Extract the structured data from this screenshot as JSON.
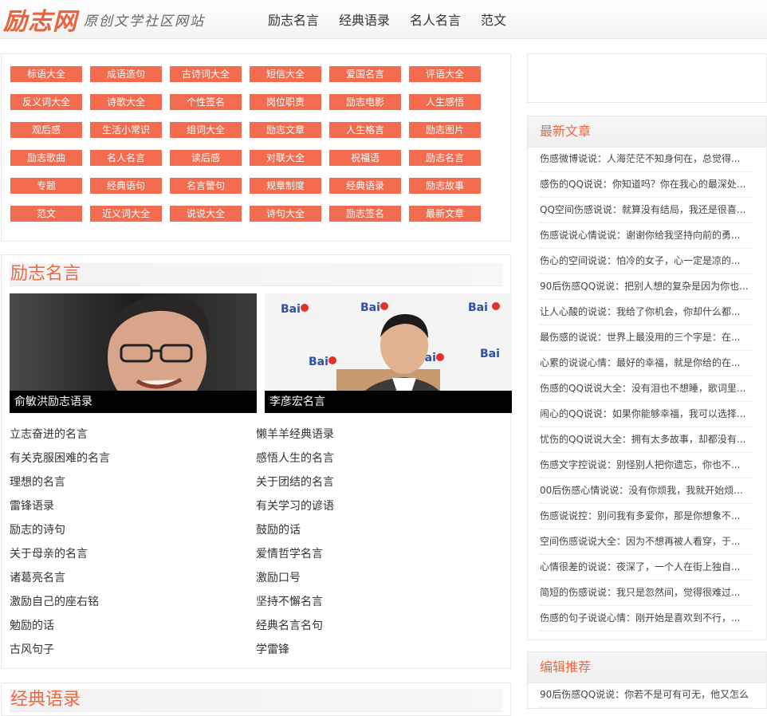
{
  "header": {
    "logo_main": "励志网",
    "logo_sub": "原创文学社区网站",
    "nav": [
      "励志名言",
      "经典语录",
      "名人名言",
      "范文"
    ]
  },
  "tags": [
    "标语大全",
    "成语造句",
    "古诗词大全",
    "短信大全",
    "爱国名言",
    "评语大全",
    "反义词大全",
    "诗歌大全",
    "个性签名",
    "岗位职责",
    "励志电影",
    "人生感悟",
    "观后感",
    "生活小常识",
    "组词大全",
    "励志文章",
    "人生格言",
    "励志图片",
    "励志歌曲",
    "名人名言",
    "读后感",
    "对联大全",
    "祝福语",
    "励志名言",
    "专题",
    "经典语句",
    "名言警句",
    "规章制度",
    "经典语录",
    "励志故事",
    "范文",
    "近义词大全",
    "说说大全",
    "诗句大全",
    "励志签名",
    "最新文章"
  ],
  "quotes_section": {
    "title": "励志名言",
    "photos": [
      {
        "caption": "俞敏洪励志语录"
      },
      {
        "caption": "李彦宏名言"
      }
    ],
    "links": [
      "立志奋进的名言",
      "懒羊羊经典语录",
      "有关克服困难的名言",
      "感悟人生的名言",
      "理想的名言",
      "关于团结的名言",
      "雷锋语录",
      "有关学习的谚语",
      "励志的诗句",
      "鼓励的话",
      "关于母亲的名言",
      "爱情哲学名言",
      "诸葛亮名言",
      "激励口号",
      "激励自己的座右铭",
      "坚持不懈名言",
      "勉励的话",
      "经典名言名句",
      "古风句子",
      "学雷锋"
    ]
  },
  "next_section": {
    "title": "经典语录"
  },
  "latest": {
    "title": "最新文章",
    "items": [
      "伤感微博说说：人海茫茫不知身何在，总觉得...",
      "感伤的QQ说说：你知道吗？你在我心的最深处...",
      "QQ空间伤感说说：就算没有结局，我还是很喜...",
      "伤感说说心情说说：谢谢你给我坚持向前的勇...",
      "伤心的空间说说：怕冷的女子，心一定是凉的...",
      "90后伤感QQ说说：把别人想的复杂是因为你也...",
      "让人心酸的说说：我给了你机会，你却什么都...",
      "最伤感的说说：世界上最没用的三个字是：在...",
      "心累的说说心情：最好的幸福，就是你给的在...",
      "伤感的QQ说说大全：没有泪也不想睡，歌词里...",
      "闹心的QQ说说：如果你能够幸福，我可以选择...",
      "忧伤的QQ说说大全：拥有太多故事，却都没有...",
      "伤感文字控说说：别怪别人把你遗忘，你也不...",
      "00后伤感心情说说：没有你烦我，我就开始烦...",
      "伤感说说控：别问我有多爱你，那是你想象不...",
      "空间伤感说说大全：因为不想再被人看穿，于...",
      "心情很差的说说：夜深了，一个人在街上独自...",
      "简短的伤感说说：我只是忽然间，觉得很难过...",
      "伤感的句子说说心情：刚开始是喜欢到不行，..."
    ]
  },
  "editor": {
    "title": "编辑推荐",
    "items": [
      "90后伤感QQ说说：你若不是可有可无，他又怎么"
    ]
  },
  "colors": {
    "accent": "#f36c4f",
    "title": "#ea6a45"
  }
}
